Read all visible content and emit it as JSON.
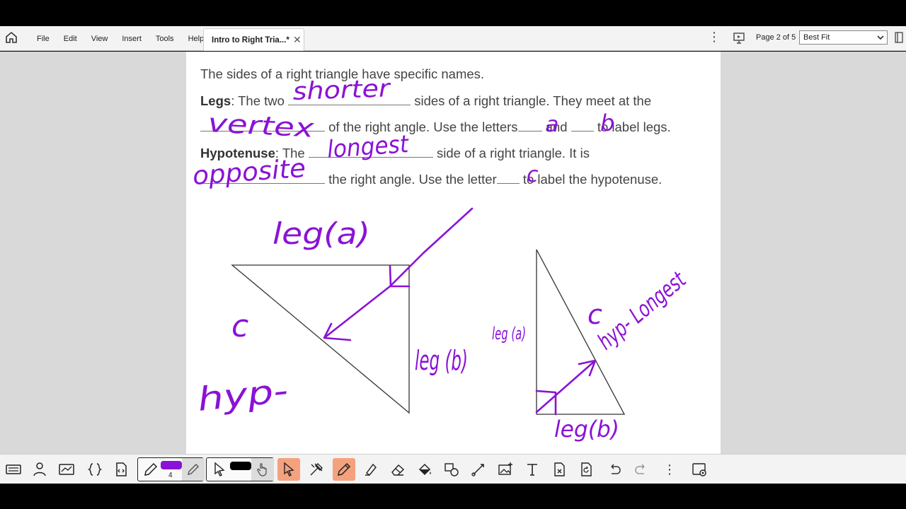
{
  "menu": {
    "items": [
      "File",
      "Edit",
      "View",
      "Insert",
      "Tools",
      "Help"
    ]
  },
  "tab": {
    "title": "Intro to Right Tria...*",
    "close": "✕"
  },
  "header": {
    "page_indicator": "Page 2 of 5",
    "zoom": "Best Fit"
  },
  "document": {
    "line1": "The sides of a right triangle have specific names.",
    "legs_label": "Legs",
    "legs_text1": ": The two",
    "legs_text2": "sides of a right triangle. They meet at the",
    "line3_text1": "of the right angle. Use the letters",
    "line3_and": "and",
    "line3_text2": "to label legs.",
    "hyp_label": "Hypotenuse",
    "hyp_text1": ": The",
    "hyp_text2": "side of a right triangle. It is",
    "line5_text1": "the right angle. Use the letter",
    "line5_text2": "to label the hypotenuse."
  },
  "handwriting": {
    "shorter": "shorter",
    "vertex": "vertex",
    "a": "a",
    "b": "b",
    "longest": "longest",
    "opposite": "opposite",
    "c": "c",
    "leg_a_top": "leg(a)",
    "c_left": "c",
    "hyp_left": "hyp-",
    "leg_b_left": "leg (b)",
    "leg_a_right": "leg (a)",
    "c_right": "c",
    "hyp_longest": "hyp- Longest",
    "leg_b_bottom": "leg(b)"
  },
  "toolbar": {
    "pen_size": "4"
  },
  "colors": {
    "ink": "#8a12d6",
    "accent_orange": "#f4a27e",
    "pen_swatch": "#8a12d6",
    "pointer_swatch": "#000000"
  }
}
